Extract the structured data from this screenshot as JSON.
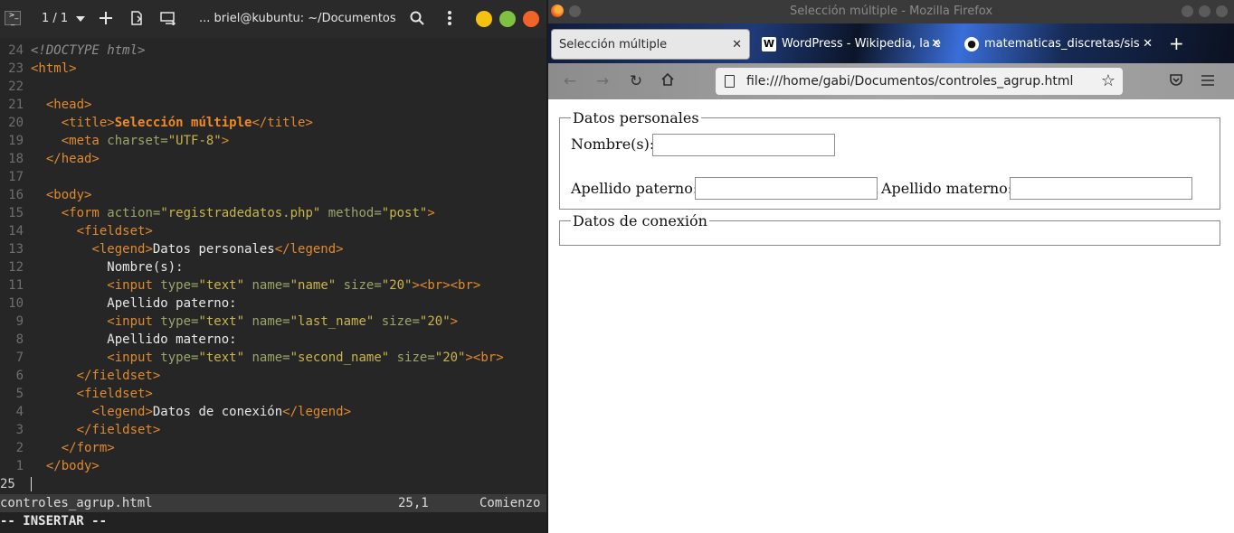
{
  "terminal": {
    "tab_counter": "1 / 1",
    "title": "... briel@kubuntu: ~/Documentos",
    "code_lines": [
      {
        "n": "24",
        "parts": [
          [
            "dt",
            "<!DOCTYPE html>"
          ]
        ]
      },
      {
        "n": "23",
        "parts": [
          [
            "tg",
            "<html>"
          ]
        ]
      },
      {
        "n": "22",
        "parts": []
      },
      {
        "n": "21",
        "parts": [
          [
            "tx",
            "  "
          ],
          [
            "tg",
            "<head>"
          ]
        ]
      },
      {
        "n": "20",
        "parts": [
          [
            "tx",
            "    "
          ],
          [
            "tg",
            "<title>"
          ],
          [
            "bold",
            "Selección múltiple"
          ],
          [
            "tg",
            "</title>"
          ]
        ]
      },
      {
        "n": "19",
        "parts": [
          [
            "tx",
            "    "
          ],
          [
            "tg",
            "<meta"
          ],
          [
            "at",
            " charset="
          ],
          [
            "st",
            "\"UTF-8\""
          ],
          [
            "tg",
            ">"
          ]
        ]
      },
      {
        "n": "18",
        "parts": [
          [
            "tx",
            "  "
          ],
          [
            "tg",
            "</head>"
          ]
        ]
      },
      {
        "n": "17",
        "parts": []
      },
      {
        "n": "16",
        "parts": [
          [
            "tx",
            "  "
          ],
          [
            "tg",
            "<body>"
          ]
        ]
      },
      {
        "n": "15",
        "parts": [
          [
            "tx",
            "    "
          ],
          [
            "tg",
            "<form"
          ],
          [
            "at",
            " action="
          ],
          [
            "st",
            "\"registradedatos.php\""
          ],
          [
            "at",
            " method="
          ],
          [
            "st",
            "\"post\""
          ],
          [
            "tg",
            ">"
          ]
        ]
      },
      {
        "n": "14",
        "parts": [
          [
            "tx",
            "      "
          ],
          [
            "tg",
            "<fieldset>"
          ]
        ]
      },
      {
        "n": "13",
        "parts": [
          [
            "tx",
            "        "
          ],
          [
            "tg",
            "<legend>"
          ],
          [
            "tx",
            "Datos personales"
          ],
          [
            "tg",
            "</legend>"
          ]
        ]
      },
      {
        "n": "12",
        "parts": [
          [
            "tx",
            "          Nombre(s):"
          ]
        ]
      },
      {
        "n": "11",
        "parts": [
          [
            "tx",
            "          "
          ],
          [
            "tg",
            "<input"
          ],
          [
            "at",
            " type="
          ],
          [
            "st",
            "\"text\""
          ],
          [
            "at",
            " name="
          ],
          [
            "st",
            "\"name\""
          ],
          [
            "at",
            " size="
          ],
          [
            "st",
            "\"20\""
          ],
          [
            "tg",
            "><br><br>"
          ]
        ]
      },
      {
        "n": "10",
        "parts": [
          [
            "tx",
            "          Apellido paterno:"
          ]
        ]
      },
      {
        "n": "9",
        "parts": [
          [
            "tx",
            "          "
          ],
          [
            "tg",
            "<input"
          ],
          [
            "at",
            " type="
          ],
          [
            "st",
            "\"text\""
          ],
          [
            "at",
            " name="
          ],
          [
            "st",
            "\"last_name\""
          ],
          [
            "at",
            " size="
          ],
          [
            "st",
            "\"20\""
          ],
          [
            "tg",
            ">"
          ]
        ]
      },
      {
        "n": "8",
        "parts": [
          [
            "tx",
            "          Apellido materno:"
          ]
        ]
      },
      {
        "n": "7",
        "parts": [
          [
            "tx",
            "          "
          ],
          [
            "tg",
            "<input"
          ],
          [
            "at",
            " type="
          ],
          [
            "st",
            "\"text\""
          ],
          [
            "at",
            " name="
          ],
          [
            "st",
            "\"second_name\""
          ],
          [
            "at",
            " size="
          ],
          [
            "st",
            "\"20\""
          ],
          [
            "tg",
            "><br>"
          ]
        ]
      },
      {
        "n": "6",
        "parts": [
          [
            "tx",
            "      "
          ],
          [
            "tg",
            "</fieldset>"
          ]
        ]
      },
      {
        "n": "5",
        "parts": [
          [
            "tx",
            "      "
          ],
          [
            "tg",
            "<fieldset>"
          ]
        ]
      },
      {
        "n": "4",
        "parts": [
          [
            "tx",
            "        "
          ],
          [
            "tg",
            "<legend>"
          ],
          [
            "tx",
            "Datos de conexión"
          ],
          [
            "tg",
            "</legend>"
          ]
        ]
      },
      {
        "n": "3",
        "parts": [
          [
            "tx",
            "      "
          ],
          [
            "tg",
            "</fieldset>"
          ]
        ]
      },
      {
        "n": "2",
        "parts": [
          [
            "tx",
            "    "
          ],
          [
            "tg",
            "</form>"
          ]
        ]
      },
      {
        "n": "1",
        "parts": [
          [
            "tx",
            "  "
          ],
          [
            "tg",
            "</body>"
          ]
        ]
      },
      {
        "n": "25",
        "parts": [],
        "current": true
      }
    ],
    "status": {
      "filename": "controles_agrup.html",
      "position": "25,1",
      "location": "Comienzo"
    },
    "mode": "-- INSERTAR --"
  },
  "firefox": {
    "window_title": "Selección múltiple - Mozilla Firefox",
    "tabs": [
      {
        "label": "Selección múltiple",
        "active": true
      },
      {
        "label": "WordPress - Wikipedia, la e",
        "favicon": "W"
      },
      {
        "label": "matematicas_discretas/sis",
        "favicon": "gh"
      }
    ],
    "url": "file:///home/gabi/Documentos/controles_agrup.html",
    "page": {
      "fieldset1_legend": "Datos personales",
      "label_name": "Nombre(s):",
      "label_last": "Apellido paterno:",
      "label_second": "Apellido materno:",
      "fieldset2_legend": "Datos de conexión",
      "value_name": "",
      "value_last": "",
      "value_second": ""
    }
  },
  "colors": {
    "terminal_bg": "#262626",
    "tag_orange": "#e08a2e",
    "attr_green": "#9aa56a",
    "string_yellow": "#c9b44b",
    "btn_yellow": "#f5c211",
    "btn_green": "#7fc241",
    "btn_orange": "#f0642a"
  }
}
